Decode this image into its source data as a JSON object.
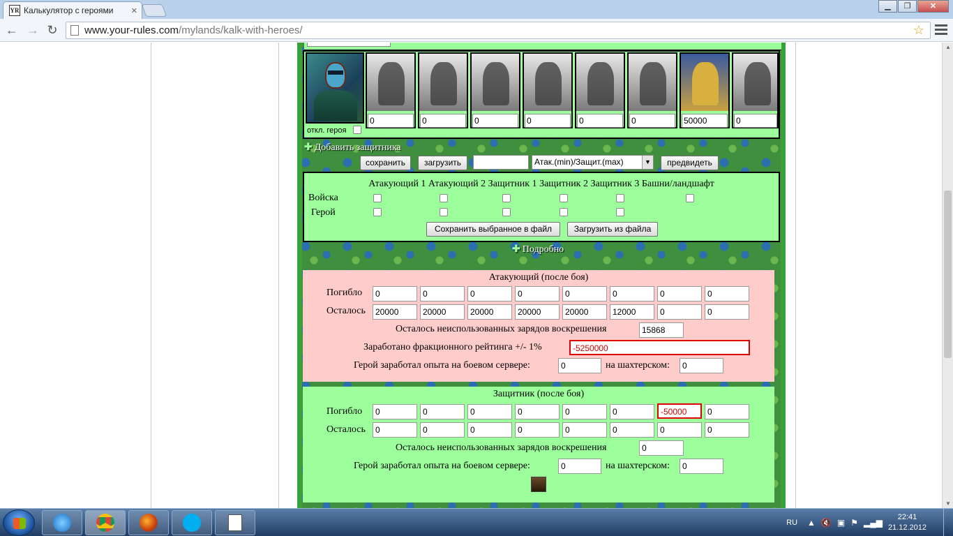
{
  "browser": {
    "tab_title": "Калькулятор с героями",
    "favicon_text": "YR",
    "url_domain": "www.your-rules.com",
    "url_path": "/mylands/kalk-with-heroes/"
  },
  "hero": {
    "disable_label": "откл. героя"
  },
  "units": {
    "values": [
      "0",
      "0",
      "0",
      "0",
      "0",
      "0",
      "50000",
      "0"
    ]
  },
  "add_defender": "Добавить защитника",
  "actions": {
    "save": "сохранить",
    "load": "загрузить",
    "mode_selected": "Атак.(min)/Защит.(max)",
    "predict": "предвидеть"
  },
  "save_panel": {
    "header": "Атакующий 1 Атакующий 2 Защитник 1 Защитник 2 Защитник 3 Башни/ландшафт",
    "row_troops": "Войска",
    "row_hero": "Герой",
    "save_to_file": "Сохранить выбранное в файл",
    "load_from_file": "Загрузить из файла"
  },
  "detail_link": "Подробно",
  "attacker": {
    "title": "Атакующий (после боя)",
    "lost_label": "Погибло",
    "remaining_label": "Осталось",
    "lost": [
      "0",
      "0",
      "0",
      "0",
      "0",
      "0",
      "0",
      "0"
    ],
    "remaining": [
      "20000",
      "20000",
      "20000",
      "20000",
      "20000",
      "12000",
      "0",
      "0"
    ],
    "resurrect_label": "Осталось неиспользованных зарядов воскрешения",
    "resurrect_value": "15868",
    "rating_label": "Заработано фракционного рейтинга +/- 1%",
    "rating_value": "-5250000",
    "exp_label": "Герой заработал опыта на боевом сервере:",
    "exp_value": "0",
    "mine_label": "на шахтерском:",
    "mine_value": "0"
  },
  "defender": {
    "title": "Защитник (после боя)",
    "lost_label": "Погибло",
    "remaining_label": "Осталось",
    "lost": [
      "0",
      "0",
      "0",
      "0",
      "0",
      "0",
      "-50000",
      "0"
    ],
    "remaining": [
      "0",
      "0",
      "0",
      "0",
      "0",
      "0",
      "0",
      "0"
    ],
    "resurrect_label": "Осталось неиспользованных зарядов воскрешения",
    "resurrect_value": "0",
    "exp_label": "Герой заработал опыта на боевом сервере:",
    "exp_value": "0",
    "mine_label": "на шахтерском:",
    "mine_value": "0"
  },
  "taskbar": {
    "lang": "RU",
    "time": "22:41",
    "date": "21.12.2012"
  },
  "colors": {
    "panel_green": "#9cff9c",
    "panel_pink": "#ffcccc",
    "error_red": "#e00000"
  }
}
